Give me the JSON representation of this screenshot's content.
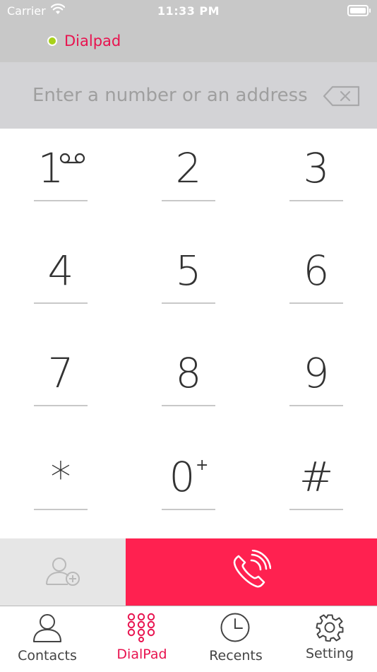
{
  "status_bar": {
    "carrier": "Carrier",
    "time": "11:33 PM"
  },
  "header": {
    "status_label": "Dialpad",
    "status_color": "#a8d11b"
  },
  "entry": {
    "placeholder": "Enter a number or an address",
    "value": ""
  },
  "keypad": {
    "keys": [
      {
        "digit": "1",
        "sup": "voicemail-icon"
      },
      {
        "digit": "2",
        "sup": ""
      },
      {
        "digit": "3",
        "sup": ""
      },
      {
        "digit": "4",
        "sup": ""
      },
      {
        "digit": "5",
        "sup": ""
      },
      {
        "digit": "6",
        "sup": ""
      },
      {
        "digit": "7",
        "sup": ""
      },
      {
        "digit": "8",
        "sup": ""
      },
      {
        "digit": "9",
        "sup": ""
      },
      {
        "digit": "*",
        "sup": ""
      },
      {
        "digit": "0",
        "sup": "+"
      },
      {
        "digit": "#",
        "sup": ""
      }
    ]
  },
  "actions": {
    "add_contact_icon": "add-contact-icon",
    "call_icon": "phone-call-icon",
    "call_color": "#ff2150"
  },
  "tabs": [
    {
      "label": "Contacts",
      "icon": "person-icon",
      "active": false
    },
    {
      "label": "DialPad",
      "icon": "dialpad-grid-icon",
      "active": true
    },
    {
      "label": "Recents",
      "icon": "clock-icon",
      "active": false
    },
    {
      "label": "Setting",
      "icon": "gear-icon",
      "active": false
    }
  ],
  "colors": {
    "accent": "#e8134f",
    "call_button": "#ff2150",
    "header_bg": "#c8c8c8",
    "entry_bg": "#d3d3d6"
  }
}
